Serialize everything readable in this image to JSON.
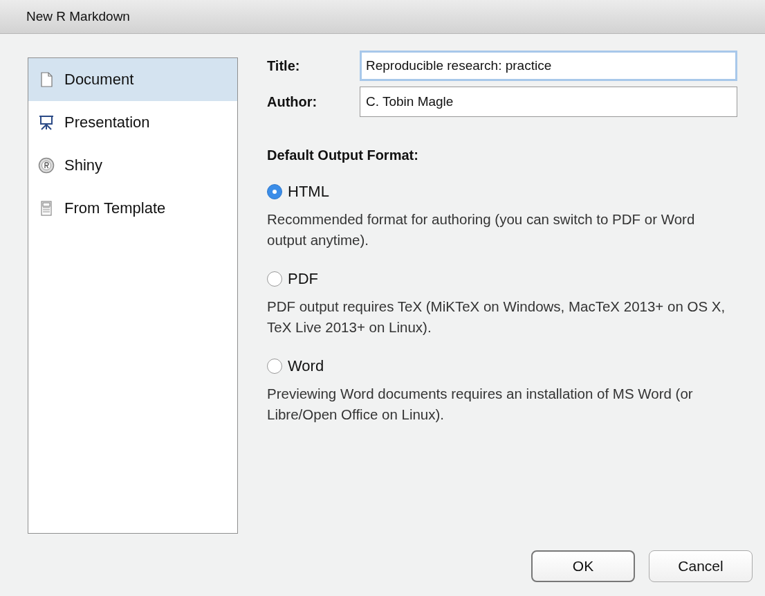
{
  "window": {
    "title": "New R Markdown"
  },
  "sidebar": {
    "items": [
      {
        "label": "Document",
        "kind": "document",
        "selected": true
      },
      {
        "label": "Presentation",
        "kind": "presentation",
        "selected": false
      },
      {
        "label": "Shiny",
        "kind": "shiny",
        "selected": false
      },
      {
        "label": "From Template",
        "kind": "template",
        "selected": false
      }
    ]
  },
  "form": {
    "fields": [
      {
        "label": "Title:",
        "value": "Reproducible research: practice",
        "focused": true
      },
      {
        "label": "Author:",
        "value": "C. Tobin Magle",
        "focused": false
      }
    ],
    "output_heading": "Default Output Format:",
    "formats": [
      {
        "label": "HTML",
        "selected": true,
        "description": "Recommended format for authoring (you can switch to PDF or Word output anytime)."
      },
      {
        "label": "PDF",
        "selected": false,
        "description": "PDF output requires TeX (MiKTeX on Windows, MacTeX 2013+ on OS X, TeX Live 2013+ on Linux)."
      },
      {
        "label": "Word",
        "selected": false,
        "description": "Previewing Word documents requires an installation of MS Word (or Libre/Open Office on Linux)."
      }
    ]
  },
  "buttons": [
    {
      "label": "OK",
      "default": true
    },
    {
      "label": "Cancel",
      "default": false
    }
  ]
}
